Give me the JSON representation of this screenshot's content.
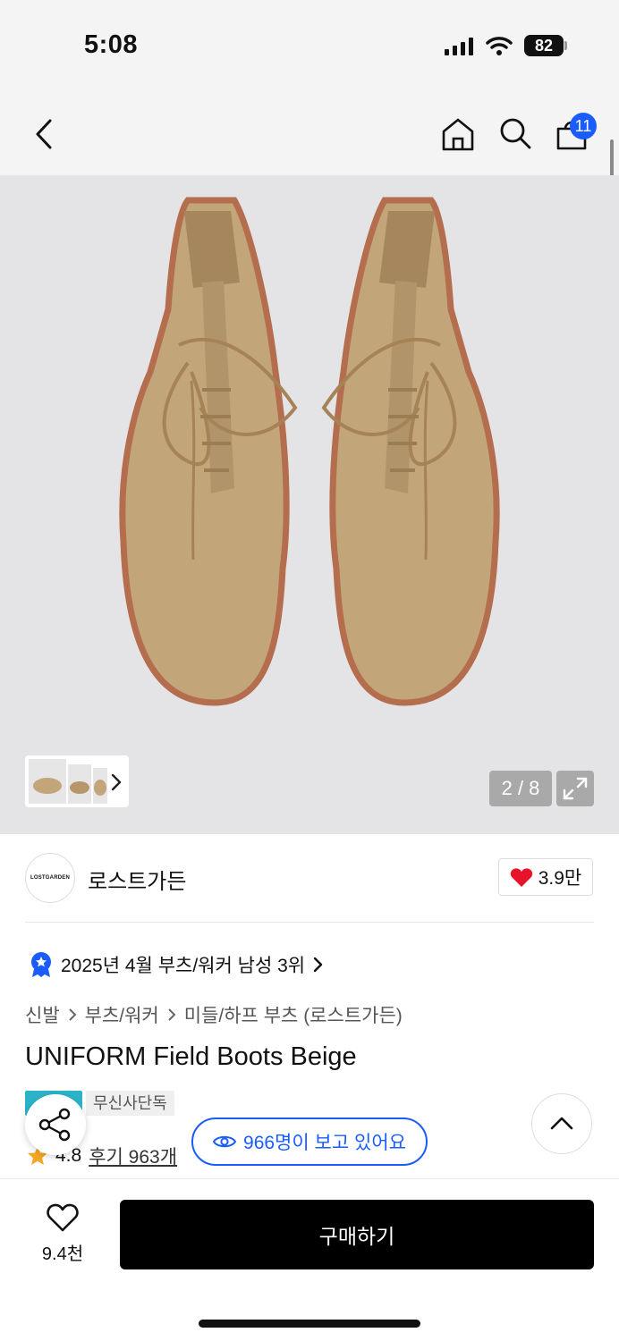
{
  "status_bar": {
    "time": "5:08",
    "battery": "82"
  },
  "header": {
    "cart_count": "11"
  },
  "gallery": {
    "counter": "2 / 8"
  },
  "brand": {
    "logo_text": "LOSTGARDEN",
    "name": "로스트가든",
    "likes": "3.9만"
  },
  "ranking": {
    "text": "2025년 4월 부츠/워커 남성 3위"
  },
  "breadcrumb": {
    "items": [
      "신발",
      "부츠/워커",
      "미들/하프 부츠 (로스트가든)"
    ]
  },
  "product": {
    "title": "UNIFORM Field Boots Beige",
    "exclusive_tag": "무신사단독"
  },
  "rating": {
    "score": "4.8",
    "reviews": "후기 963개"
  },
  "viewers": {
    "text": "966명이 보고 있어요"
  },
  "bottom_bar": {
    "wish_count": "9.4천",
    "buy_label": "구매하기"
  },
  "colors": {
    "accent": "#1a5cff",
    "teal": "#2bb4c9",
    "heart": "#e8132b",
    "star": "#f5a623"
  }
}
